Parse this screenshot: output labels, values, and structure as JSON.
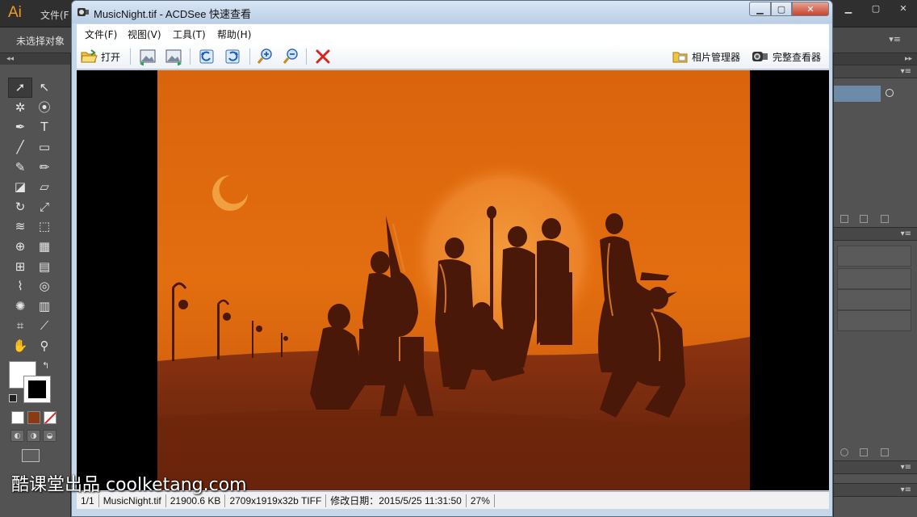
{
  "illustrator": {
    "logo": "Ai",
    "menu_file": "文件(F",
    "control_bar_text": "未选择对象",
    "collapse_left": "◂◂",
    "collapse_right": "▸▸"
  },
  "acdsee": {
    "title": "MusicNight.tif - ACDSee 快速查看",
    "menu": [
      "文件(F)",
      "视图(V)",
      "工具(T)",
      "帮助(H)"
    ],
    "toolbar": {
      "open_label": "打开",
      "photo_manager_label": "相片管理器",
      "full_viewer_label": "完整查看器"
    },
    "status": {
      "page": "1/1",
      "filename": "MusicNight.tif",
      "filesize": "21900.6 KB",
      "dimensions": "2709x1919x32b TIFF",
      "modified": "修改日期：2015/5/25 11:31:50",
      "zoom": "27%"
    },
    "colors": {
      "image_bg_top": "#e0700f",
      "image_bg_bottom": "#7a2a0c",
      "silhouette": "#4a1808",
      "close_red": "#d9241c"
    }
  },
  "watermark": "酷课堂出品 coolketang.com"
}
